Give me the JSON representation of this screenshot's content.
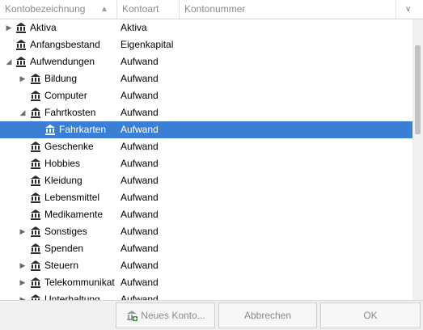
{
  "header": {
    "col_name": "Kontobezeichnung",
    "col_type": "Kontoart",
    "col_number": "Kontonummer"
  },
  "rows": [
    {
      "name": "Aktiva",
      "type": "Aktiva",
      "level": 0,
      "expander": "collapsed"
    },
    {
      "name": "Anfangsbestand",
      "type": "Eigenkapital",
      "level": 0,
      "expander": "none"
    },
    {
      "name": "Aufwendungen",
      "type": "Aufwand",
      "level": 0,
      "expander": "expanded"
    },
    {
      "name": "Bildung",
      "type": "Aufwand",
      "level": 1,
      "expander": "collapsed"
    },
    {
      "name": "Computer",
      "type": "Aufwand",
      "level": 1,
      "expander": "none"
    },
    {
      "name": "Fahrtkosten",
      "type": "Aufwand",
      "level": 1,
      "expander": "expanded"
    },
    {
      "name": "Fahrkarten",
      "type": "Aufwand",
      "level": 2,
      "expander": "none",
      "selected": true
    },
    {
      "name": "Geschenke",
      "type": "Aufwand",
      "level": 1,
      "expander": "none"
    },
    {
      "name": "Hobbies",
      "type": "Aufwand",
      "level": 1,
      "expander": "none"
    },
    {
      "name": "Kleidung",
      "type": "Aufwand",
      "level": 1,
      "expander": "none"
    },
    {
      "name": "Lebensmittel",
      "type": "Aufwand",
      "level": 1,
      "expander": "none"
    },
    {
      "name": "Medikamente",
      "type": "Aufwand",
      "level": 1,
      "expander": "none"
    },
    {
      "name": "Sonstiges",
      "type": "Aufwand",
      "level": 1,
      "expander": "collapsed"
    },
    {
      "name": "Spenden",
      "type": "Aufwand",
      "level": 1,
      "expander": "none"
    },
    {
      "name": "Steuern",
      "type": "Aufwand",
      "level": 1,
      "expander": "collapsed"
    },
    {
      "name": "Telekommunikat",
      "type": "Aufwand",
      "level": 1,
      "expander": "collapsed"
    },
    {
      "name": "Unterhaltung",
      "type": "Aufwand",
      "level": 1,
      "expander": "collapsed"
    }
  ],
  "buttons": {
    "new_account": "Neues Konto...",
    "cancel": "Abbrechen",
    "ok": "OK"
  },
  "colors": {
    "selection": "#3a7fd5",
    "disabled_text": "#8a8a8a"
  },
  "icons": {
    "account": "bank-icon",
    "sort": "sort-ascending-icon",
    "column_menu": "chevron-down-icon",
    "new_account": "add-account-icon"
  }
}
